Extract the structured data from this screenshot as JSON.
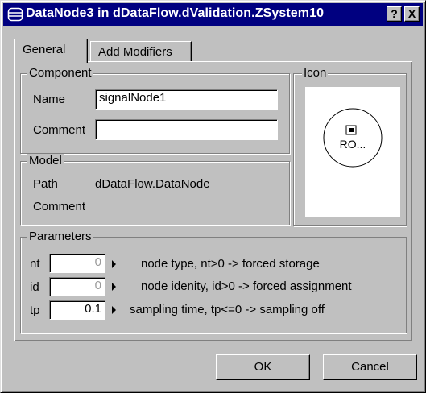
{
  "window": {
    "title": "DataNode3 in dDataFlow.dValidation.ZSystem10",
    "help_label": "?",
    "close_label": "X"
  },
  "tabs": [
    {
      "label": "General",
      "active": true
    },
    {
      "label": "Add Modifiers",
      "active": false
    }
  ],
  "component": {
    "legend": "Component",
    "name_label": "Name",
    "name_value": "signalNode1",
    "comment_label": "Comment",
    "comment_value": ""
  },
  "icon": {
    "legend": "Icon",
    "preview_text": "RO..."
  },
  "model": {
    "legend": "Model",
    "path_label": "Path",
    "path_value": "dDataFlow.DataNode",
    "comment_label": "Comment",
    "comment_value": ""
  },
  "parameters": {
    "legend": "Parameters",
    "rows": [
      {
        "name": "nt",
        "value": "0",
        "default": true,
        "description": "node type, nt>0 -> forced storage"
      },
      {
        "name": "id",
        "value": "0",
        "default": true,
        "description": "node idenity, id>0 -> forced assignment"
      },
      {
        "name": "tp",
        "value": "0.1",
        "default": false,
        "description": "sampling time, tp<=0 -> sampling off"
      }
    ]
  },
  "buttons": {
    "ok": "OK",
    "cancel": "Cancel"
  }
}
